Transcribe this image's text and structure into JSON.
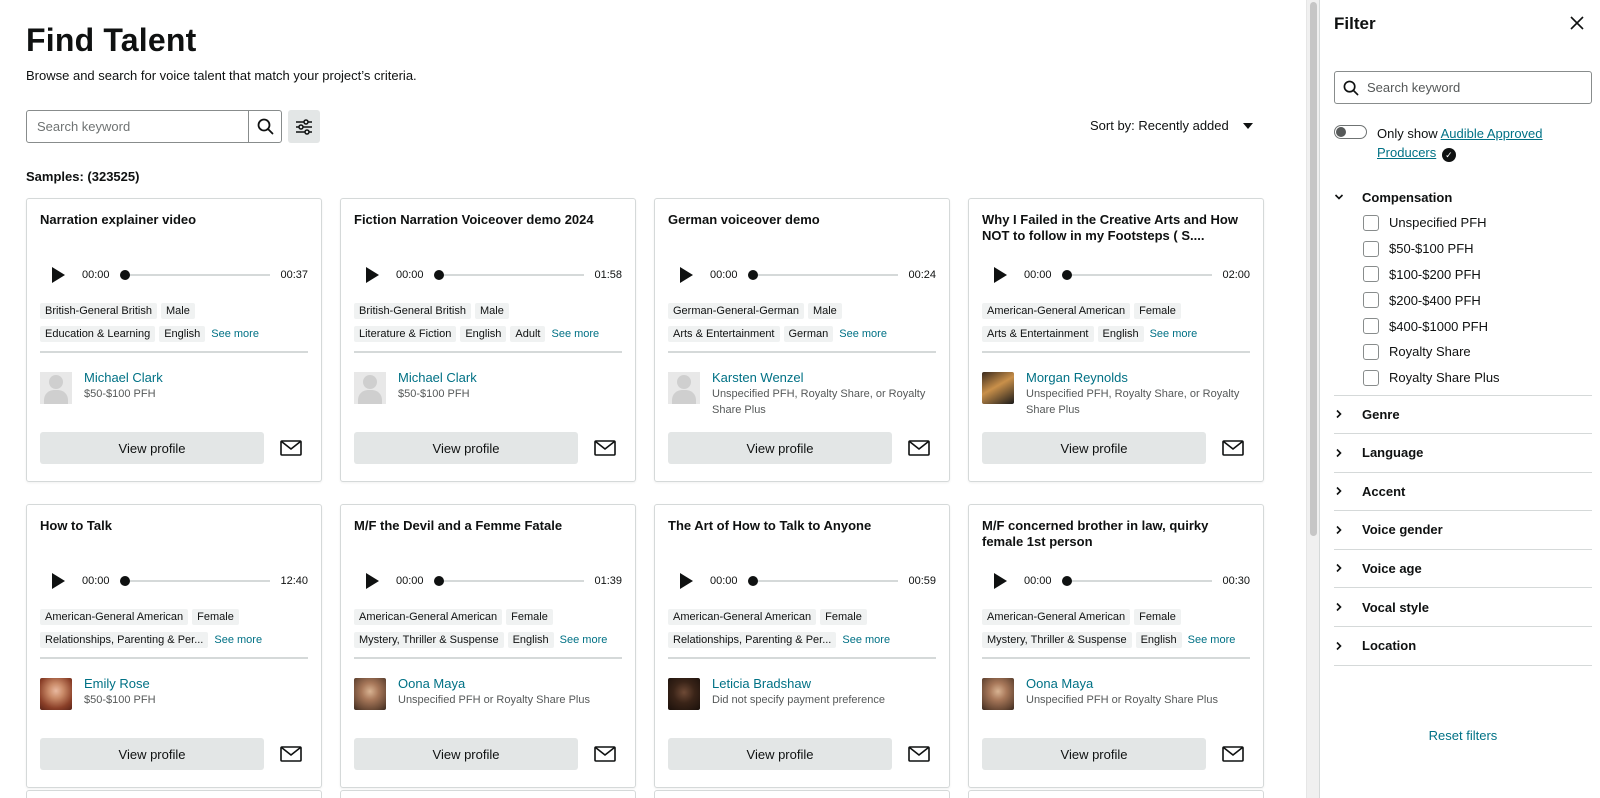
{
  "header": {
    "title": "Find Talent",
    "subtitle": "Browse and search for voice talent that match your project’s criteria."
  },
  "search": {
    "placeholder": "Search keyword"
  },
  "sort": {
    "label": "Sort by: Recently added"
  },
  "samples_label": "Samples: (323525)",
  "colors": {
    "accent_link": "#007185",
    "button_bg": "#e3e6e6",
    "border": "#d5d9d9"
  },
  "cards": [
    {
      "title": "Narration explainer video",
      "time_current": "00:00",
      "time_total": "00:37",
      "tags_row1": [
        "British-General British",
        "Male"
      ],
      "tags_row2": [
        "Education & Learning",
        "English"
      ],
      "see_more": "See more",
      "talent_name": "Michael Clark",
      "pay": "$50-$100 PFH",
      "view_label": "View profile"
    },
    {
      "title": "Fiction Narration Voiceover demo 2024",
      "time_current": "00:00",
      "time_total": "01:58",
      "tags_row1": [
        "British-General British",
        "Male"
      ],
      "tags_row2": [
        "Literature & Fiction",
        "English",
        "Adult"
      ],
      "see_more": "See more",
      "talent_name": "Michael Clark",
      "pay": "$50-$100 PFH",
      "view_label": "View profile"
    },
    {
      "title": "German voiceover demo",
      "time_current": "00:00",
      "time_total": "00:24",
      "tags_row1": [
        "German-General-German",
        "Male"
      ],
      "tags_row2": [
        "Arts & Entertainment",
        "German"
      ],
      "see_more": "See more",
      "talent_name": "Karsten Wenzel",
      "pay": "Unspecified PFH, Royalty Share, or Royalty Share Plus",
      "view_label": "View profile"
    },
    {
      "title": "Why I Failed in the Creative Arts and How NOT to follow in my Footsteps ( S....",
      "time_current": "00:00",
      "time_total": "02:00",
      "tags_row1": [
        "American-General American",
        "Female"
      ],
      "tags_row2": [
        "Arts & Entertainment",
        "English"
      ],
      "see_more": "See more",
      "talent_name": "Morgan Reynolds",
      "pay": "Unspecified PFH, Royalty Share, or Royalty Share Plus",
      "view_label": "View profile"
    },
    {
      "title": "How to Talk",
      "time_current": "00:00",
      "time_total": "12:40",
      "tags_row1": [
        "American-General American",
        "Female"
      ],
      "tags_row2": [
        "Relationships, Parenting & Per..."
      ],
      "see_more": "See more",
      "talent_name": "Emily Rose",
      "pay": "$50-$100 PFH",
      "view_label": "View profile"
    },
    {
      "title": "M/F the Devil and a Femme Fatale",
      "time_current": "00:00",
      "time_total": "01:39",
      "tags_row1": [
        "American-General American",
        "Female"
      ],
      "tags_row2": [
        "Mystery, Thriller & Suspense",
        "English"
      ],
      "see_more": "See more",
      "talent_name": "Oona Maya",
      "pay": "Unspecified PFH or Royalty Share Plus",
      "view_label": "View profile"
    },
    {
      "title": "The Art of How to Talk to Anyone",
      "time_current": "00:00",
      "time_total": "00:59",
      "tags_row1": [
        "American-General American",
        "Female"
      ],
      "tags_row2": [
        "Relationships, Parenting & Per..."
      ],
      "see_more": "See more",
      "talent_name": "Leticia Bradshaw",
      "pay": "Did not specify payment preference",
      "view_label": "View profile"
    },
    {
      "title": "M/F concerned brother in law, quirky female 1st person",
      "time_current": "00:00",
      "time_total": "00:30",
      "tags_row1": [
        "American-General American",
        "Female"
      ],
      "tags_row2": [
        "Mystery, Thriller & Suspense",
        "English"
      ],
      "see_more": "See more",
      "talent_name": "Oona Maya",
      "pay": "Unspecified PFH or Royalty Share Plus",
      "view_label": "View profile"
    }
  ],
  "filter": {
    "title": "Filter",
    "search_placeholder": "Search keyword",
    "toggle_prefix": "Only show",
    "toggle_link": "Audible Approved Producers",
    "toggle_on": false,
    "compensation": {
      "label": "Compensation",
      "options": [
        "Unspecified PFH",
        "$50-$100 PFH",
        "$100-$200 PFH",
        "$200-$400 PFH",
        "$400-$1000 PFH",
        "Royalty Share",
        "Royalty Share Plus"
      ]
    },
    "sections": [
      "Genre",
      "Language",
      "Accent",
      "Voice gender",
      "Voice age",
      "Vocal style",
      "Location"
    ],
    "reset_label": "Reset filters"
  }
}
